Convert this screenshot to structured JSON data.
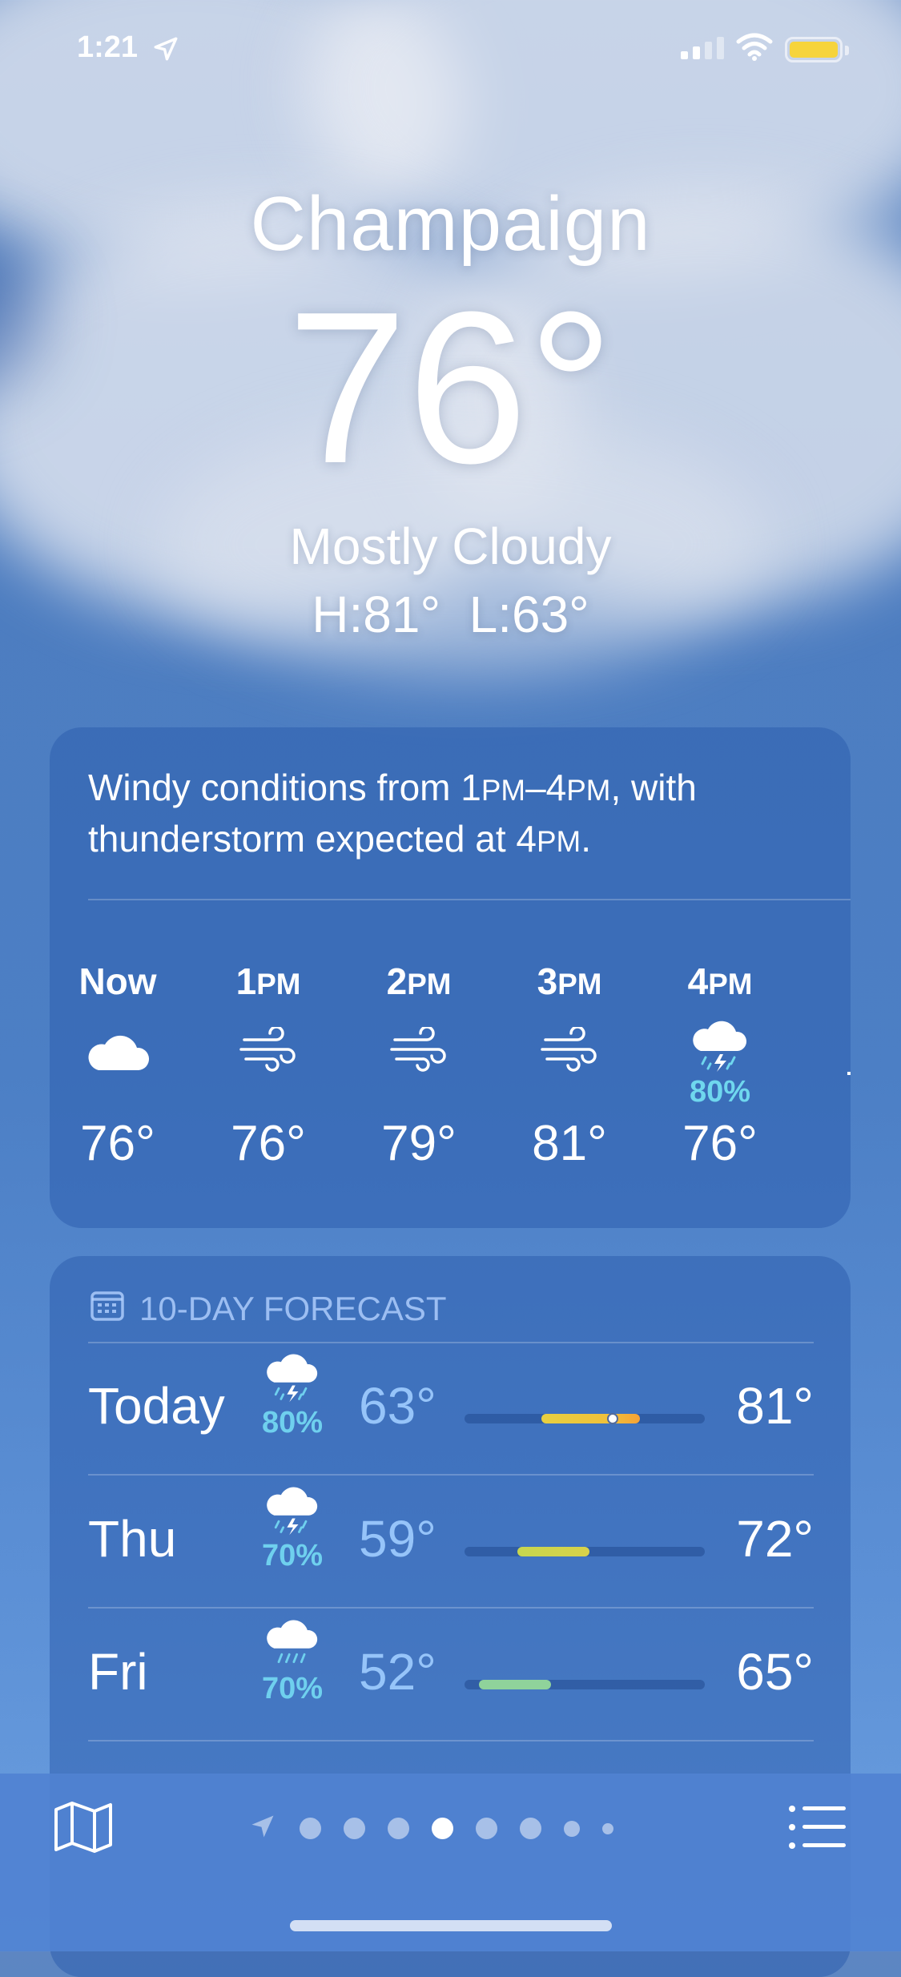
{
  "status_bar": {
    "time": "1:21"
  },
  "location": {
    "city": "Champaign",
    "temperature": "76°",
    "condition": "Mostly Cloudy",
    "high_low": "H:81°  L:63°"
  },
  "hourly": {
    "summary": {
      "lead": "Windy conditions from 1",
      "pm1": "PM",
      "dash": "–4",
      "pm2": "PM",
      "mid": ", with thunderstorm expected at 4",
      "pm3": "PM",
      "end": "."
    },
    "hours": [
      {
        "label": "Now",
        "icon": "cloud-icon",
        "temp": "76°",
        "pop": ""
      },
      {
        "label_num": "1",
        "label_sc": "PM",
        "icon": "wind-icon",
        "temp": "76°",
        "pop": ""
      },
      {
        "label_num": "2",
        "label_sc": "PM",
        "icon": "wind-icon",
        "temp": "79°",
        "pop": ""
      },
      {
        "label_num": "3",
        "label_sc": "PM",
        "icon": "wind-icon",
        "temp": "81°",
        "pop": ""
      },
      {
        "label_num": "4",
        "label_sc": "PM",
        "icon": "thunderstorm-icon",
        "temp": "76°",
        "pop": "80%"
      }
    ]
  },
  "forecast": {
    "header": "10-DAY FORECAST",
    "days": [
      {
        "day": "Today",
        "icon": "thunderstorm-icon",
        "pop": "80%",
        "low": "63°",
        "high": "81°",
        "range_start": 0.32,
        "range_end": 0.73,
        "current": 0.6
      },
      {
        "day": "Thu",
        "icon": "thunderstorm-icon",
        "pop": "70%",
        "low": "59°",
        "high": "72°",
        "range_start": 0.22,
        "range_end": 0.52
      },
      {
        "day": "Fri",
        "icon": "rain-icon",
        "pop": "70%",
        "low": "52°",
        "high": "65°",
        "range_start": 0.06,
        "range_end": 0.36
      }
    ]
  },
  "pager": {
    "pages": 8,
    "active_index": 4
  },
  "colors": {
    "bar_gradient_start": "#d5d24a",
    "bar_gradient_end": "#f6a236",
    "bar_cool": "#8fd39b"
  }
}
